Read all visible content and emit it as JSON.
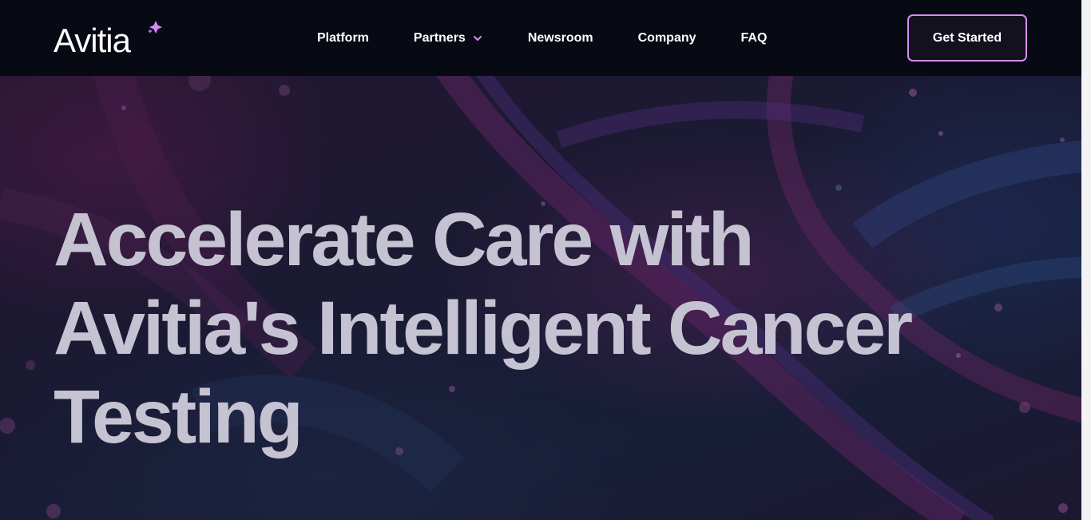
{
  "brand": {
    "name": "Avitia",
    "accent_color": "#d68cf6"
  },
  "nav": {
    "items": [
      {
        "label": "Platform",
        "has_dropdown": false
      },
      {
        "label": "Partners",
        "has_dropdown": true,
        "icon": "chevron-down-icon"
      },
      {
        "label": "Newsroom",
        "has_dropdown": false
      },
      {
        "label": "Company",
        "has_dropdown": false
      },
      {
        "label": "FAQ",
        "has_dropdown": false
      }
    ],
    "cta_label": "Get Started"
  },
  "hero": {
    "headline_line1": "Accelerate Care with",
    "headline_line2": "Avitia's Intelligent Cancer",
    "headline_line3": "Testing",
    "background_image": "dna-helix-illustration"
  }
}
